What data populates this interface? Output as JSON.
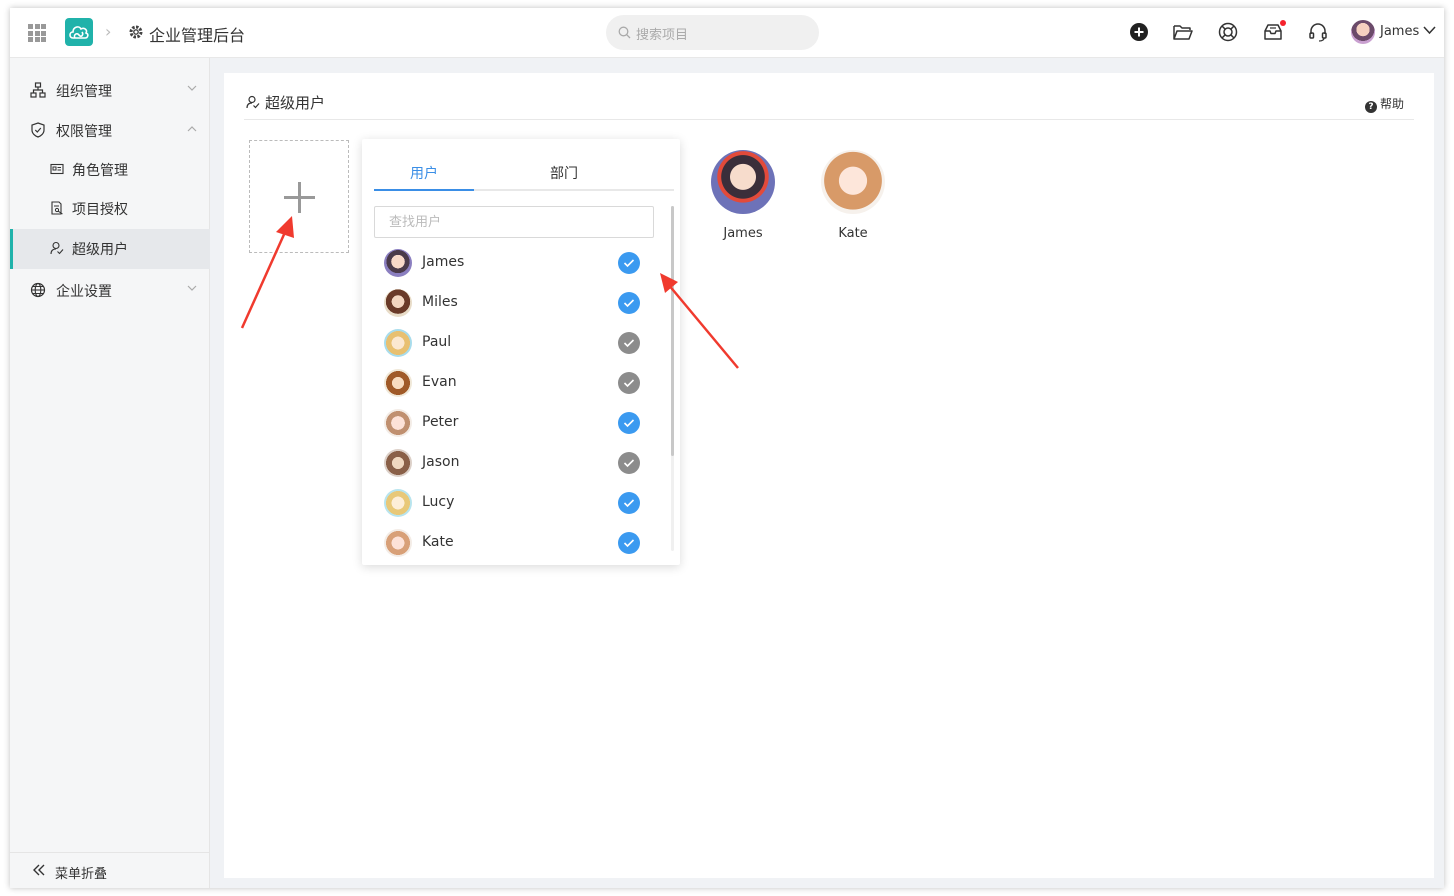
{
  "header": {
    "breadcrumb_title": "企业管理后台",
    "search_placeholder": "搜索项目",
    "user_name": "James",
    "icons": [
      "apps-grid-icon",
      "cloud-logo-icon",
      "gear-icon",
      "add-circle-icon",
      "folder-open-icon",
      "lifebuoy-icon",
      "inbox-icon",
      "headset-icon",
      "chevron-down-icon"
    ],
    "accent_color": "#20b2aa"
  },
  "sidebar": {
    "items": [
      {
        "label": "组织管理",
        "icon": "org-chart-icon",
        "expanded": false
      },
      {
        "label": "权限管理",
        "icon": "shield-icon",
        "expanded": true,
        "children": [
          {
            "label": "角色管理",
            "icon": "id-card-icon"
          },
          {
            "label": "项目授权",
            "icon": "document-key-icon"
          },
          {
            "label": "超级用户",
            "icon": "super-user-icon",
            "active": true
          }
        ]
      },
      {
        "label": "企业设置",
        "icon": "globe-icon",
        "expanded": false
      }
    ],
    "collapse_label": "菜单折叠"
  },
  "main": {
    "title": "超级用户",
    "help_label": "帮助",
    "popover": {
      "tabs": [
        {
          "label": "用户",
          "active": true
        },
        {
          "label": "部门",
          "active": false
        }
      ],
      "search_placeholder": "查找用户",
      "users": [
        {
          "name": "James",
          "selected": true
        },
        {
          "name": "Miles",
          "selected": true
        },
        {
          "name": "Paul",
          "selected": false
        },
        {
          "name": "Evan",
          "selected": false
        },
        {
          "name": "Peter",
          "selected": true
        },
        {
          "name": "Jason",
          "selected": false
        },
        {
          "name": "Lucy",
          "selected": true
        },
        {
          "name": "Kate",
          "selected": true
        }
      ],
      "checked_color": "#3b9af0",
      "unchecked_color": "#8c8c8c"
    },
    "super_users": [
      {
        "name": "James"
      },
      {
        "name": "Kate"
      }
    ],
    "annotation_arrow_color": "#f03a2e"
  }
}
